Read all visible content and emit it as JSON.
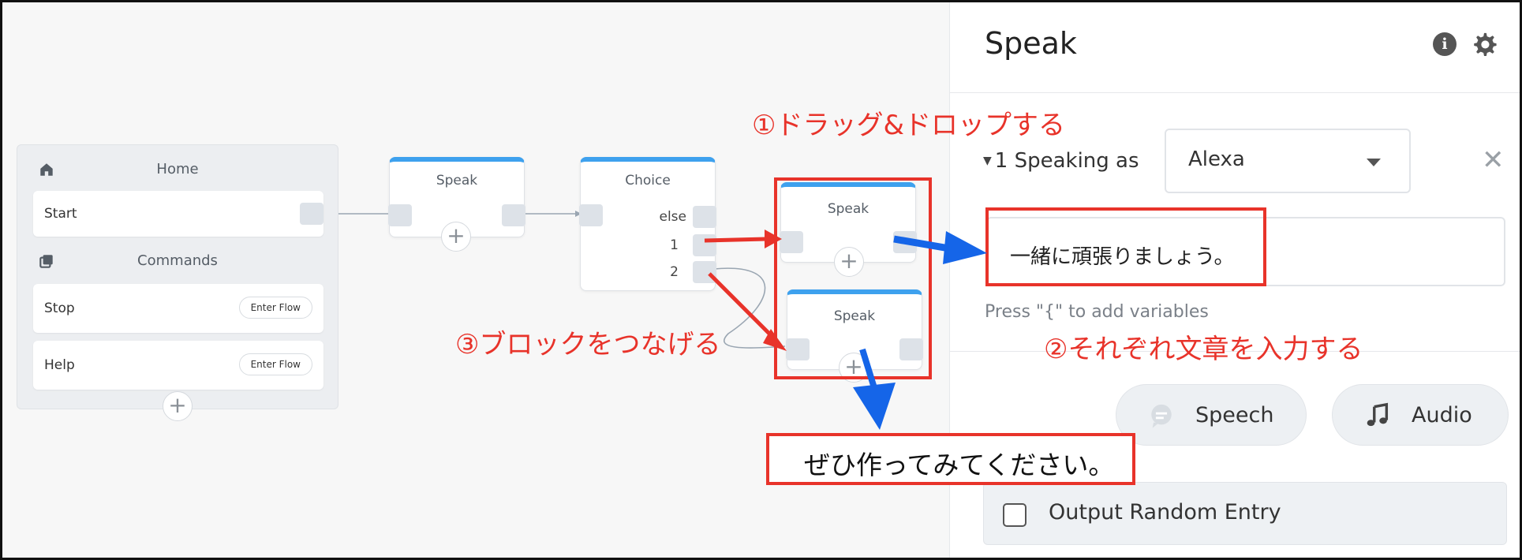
{
  "canvas": {
    "home_panel": {
      "home_label": "Home",
      "start_label": "Start",
      "commands_label": "Commands",
      "commands": [
        {
          "label": "Stop",
          "button": "Enter Flow"
        },
        {
          "label": "Help",
          "button": "Enter Flow"
        }
      ],
      "add_symbol": "+"
    },
    "blocks": {
      "speak_1": {
        "title": "Speak"
      },
      "choice": {
        "title": "Choice",
        "paths": [
          "else",
          "1",
          "2"
        ]
      },
      "speak_2": {
        "title": "Speak"
      },
      "speak_3": {
        "title": "Speak"
      }
    },
    "add_symbol": "+"
  },
  "panel": {
    "title": "Speak",
    "info_icon": "info-icon",
    "settings_icon": "gear-icon",
    "speaking_as_label": "1 Speaking as",
    "speaking_as_value": "Alexa",
    "close_symbol": "✕",
    "message_text": "一緒に頑張りましょう。",
    "hint": "Press \"{\" to add variables",
    "speech_button": "Speech",
    "audio_button": "Audio",
    "random_entry_label": "Output Random Entry"
  },
  "annotations": {
    "step1": "①ドラッグ&ドロップする",
    "step2": "②それぞれ文章を入力する",
    "step3": "③ブロックをつなげる",
    "callout": "ぜひ作ってみてください。",
    "colors": {
      "red": "#e8332a",
      "blue": "#1565e8",
      "block_accent": "#3ea1ee"
    }
  }
}
